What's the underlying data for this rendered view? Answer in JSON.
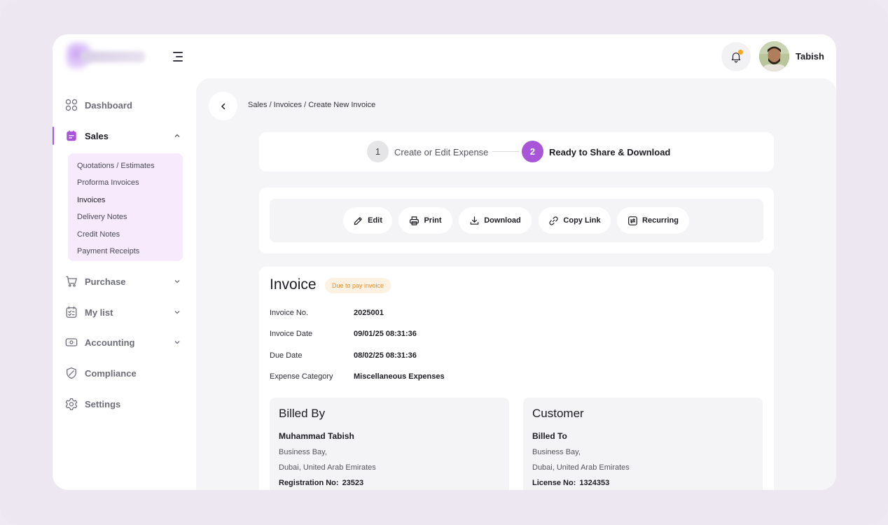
{
  "header": {
    "user_name": "Tabish"
  },
  "sidebar": {
    "items": [
      {
        "label": "Dashboard",
        "icon": "grid-icon"
      },
      {
        "label": "Sales",
        "icon": "sales-icon"
      },
      {
        "label": "Purchase",
        "icon": "cart-icon"
      },
      {
        "label": "My list",
        "icon": "list-icon"
      },
      {
        "label": "Accounting",
        "icon": "wallet-icon"
      },
      {
        "label": "Compliance",
        "icon": "shield-icon"
      },
      {
        "label": "Settings",
        "icon": "gear-icon"
      }
    ],
    "sales_submenu": [
      "Quotations / Estimates",
      "Proforma Invoices",
      "Invoices",
      "Delivery Notes",
      "Credit Notes",
      "Payment Receipts"
    ]
  },
  "breadcrumb": "Sales / Invoices / Create New Invoice",
  "steps": {
    "step1": {
      "number": "1",
      "label": "Create or Edit Expense"
    },
    "step2": {
      "number": "2",
      "label": "Ready to Share & Download"
    }
  },
  "actions": {
    "edit": "Edit",
    "print": "Print",
    "download": "Download",
    "copy_link": "Copy Link",
    "recurring": "Recurring"
  },
  "invoice": {
    "title": "Invoice",
    "status": "Due to pay invoice",
    "fields": [
      {
        "label": "Invoice No.",
        "value": "2025001"
      },
      {
        "label": "Invoice Date",
        "value": "09/01/25 08:31:36"
      },
      {
        "label": "Due Date",
        "value": "08/02/25 08:31:36"
      },
      {
        "label": "Expense Category",
        "value": "Miscellaneous Expenses"
      }
    ],
    "billed_by": {
      "heading": "Billed By",
      "name": "Muhammad Tabish",
      "address1": "Business Bay,",
      "address2": "Dubai, United Arab Emirates",
      "reg_label": "Registration No:",
      "reg_value": "23523"
    },
    "customer": {
      "heading": "Customer",
      "name": "Billed To",
      "address1": "Business Bay,",
      "address2": "Dubai, United Arab Emirates",
      "reg_label": "License No:",
      "reg_value": "1324353"
    }
  },
  "colors": {
    "accent": "#a855d8",
    "badge_text": "#e6912b",
    "badge_bg": "#fdf1e1",
    "submenu_bg": "#f7eafc"
  }
}
